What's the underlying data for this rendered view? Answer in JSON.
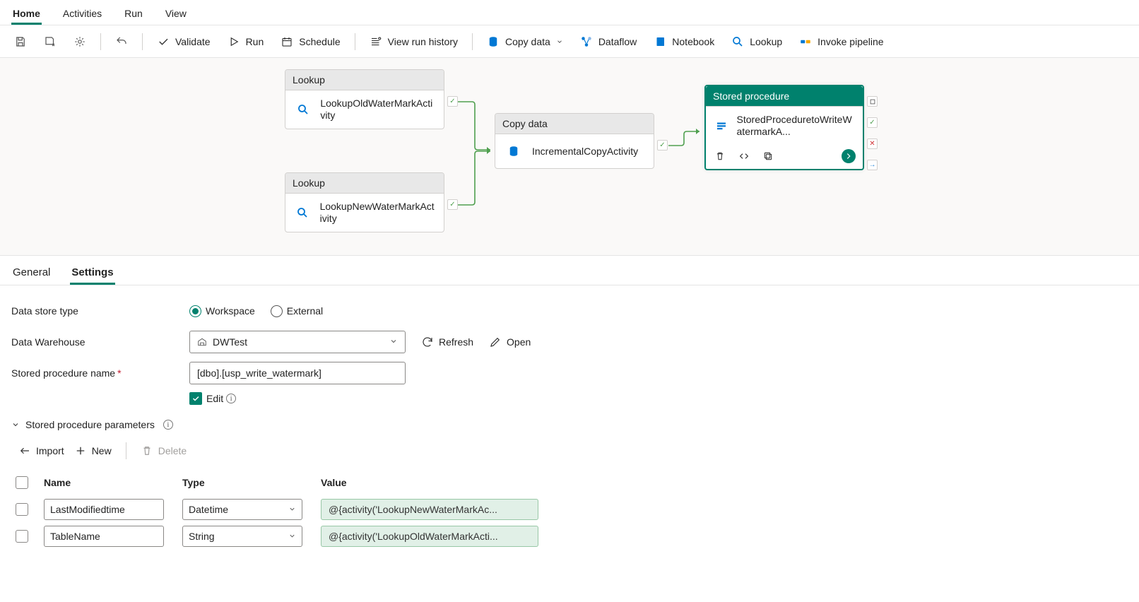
{
  "ribbon": {
    "tabs": [
      "Home",
      "Activities",
      "Run",
      "View"
    ],
    "active": "Home"
  },
  "toolbar": {
    "validate": "Validate",
    "run": "Run",
    "schedule": "Schedule",
    "history": "View run history",
    "copydata": "Copy data",
    "dataflow": "Dataflow",
    "notebook": "Notebook",
    "lookup": "Lookup",
    "invoke": "Invoke pipeline"
  },
  "activities": {
    "lookup_label": "Lookup",
    "copy_label": "Copy data",
    "stored_label": "Stored procedure",
    "a1_name": "LookupOldWaterMarkActivity",
    "a2_name": "LookupNewWaterMarkActivity",
    "copy_name": "IncrementalCopyActivity",
    "stored_name": "StoredProceduretoWriteWatermarkA..."
  },
  "panel": {
    "tabs": [
      "General",
      "Settings"
    ],
    "active": "Settings",
    "data_store_type_label": "Data store type",
    "workspace": "Workspace",
    "external": "External",
    "data_warehouse_label": "Data Warehouse",
    "data_warehouse_value": "DWTest",
    "refresh": "Refresh",
    "open": "Open",
    "sp_name_label": "Stored procedure name",
    "sp_name_value": "[dbo].[usp_write_watermark]",
    "edit": "Edit",
    "sp_params_label": "Stored procedure parameters",
    "import": "Import",
    "new": "New",
    "delete": "Delete",
    "cols": {
      "name": "Name",
      "type": "Type",
      "value": "Value"
    },
    "rows": [
      {
        "name": "LastModifiedtime",
        "type": "Datetime",
        "value": "@{activity('LookupNewWaterMarkAc..."
      },
      {
        "name": "TableName",
        "type": "String",
        "value": "@{activity('LookupOldWaterMarkActi..."
      }
    ]
  }
}
